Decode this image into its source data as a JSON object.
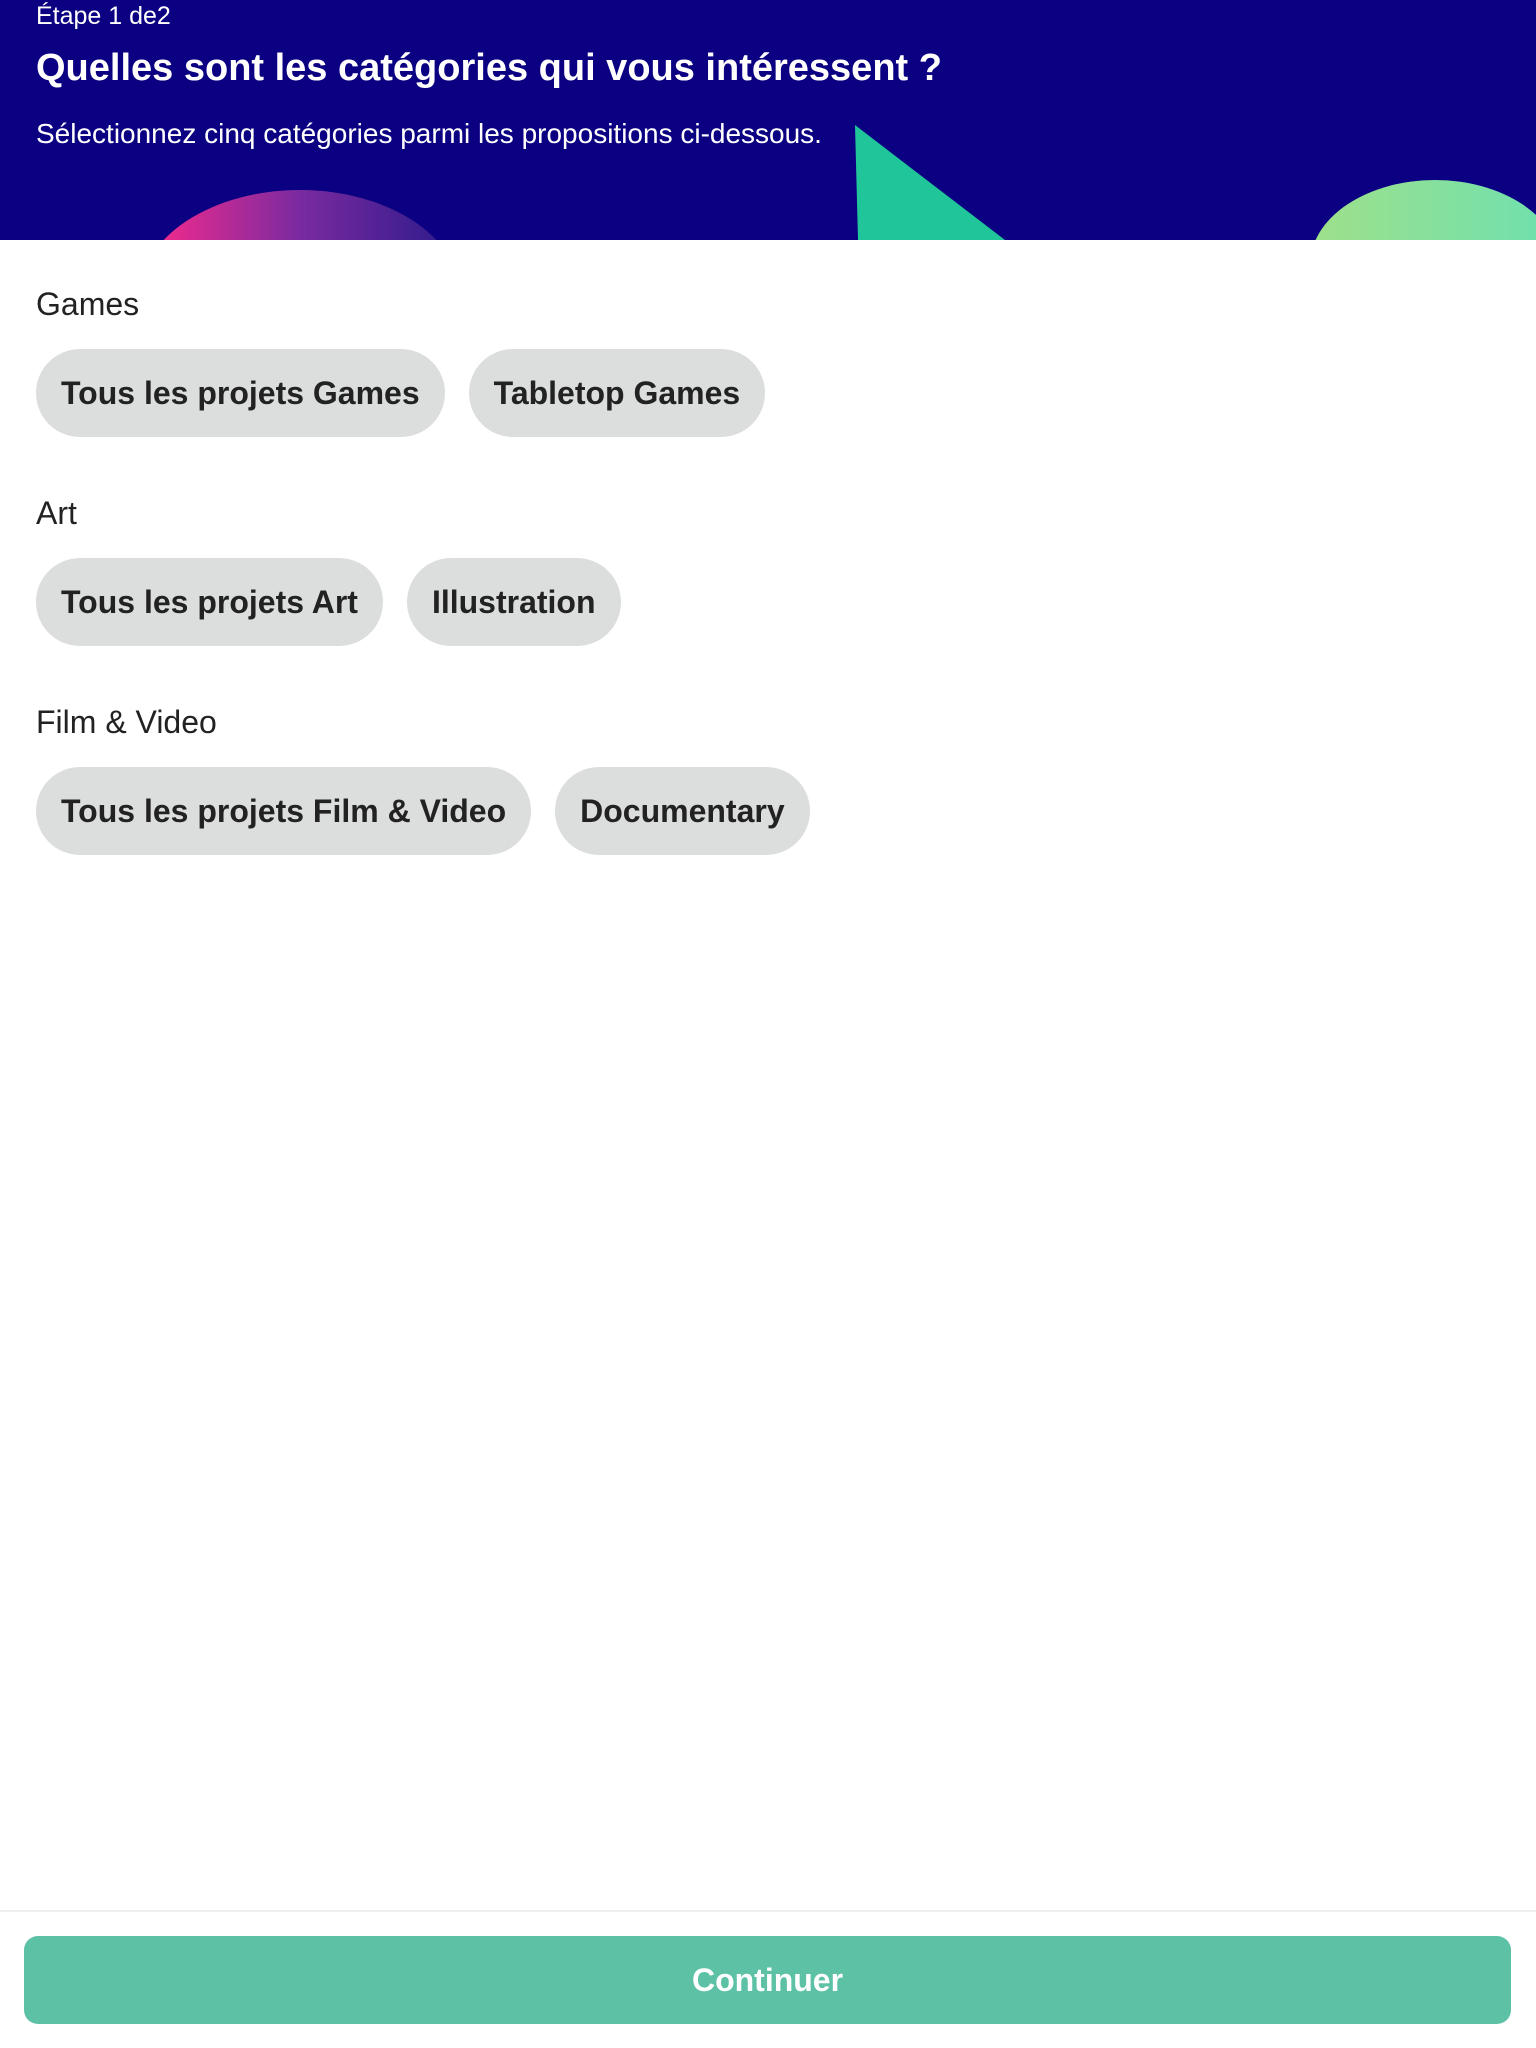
{
  "header": {
    "step": "Étape 1 de2",
    "title": "Quelles sont les catégories qui vous intéressent ?",
    "subtitle": "Sélectionnez cinq catégories parmi les propositions ci-dessous.",
    "background_color": "#0b0081"
  },
  "sections": [
    {
      "title": "Games",
      "chips": [
        "Tous les projets Games",
        "Tabletop Games"
      ]
    },
    {
      "title": "Art",
      "chips": [
        "Tous les projets Art",
        "Illustration"
      ]
    },
    {
      "title": "Film & Video",
      "chips": [
        "Tous les projets Film & Video",
        "Documentary"
      ]
    }
  ],
  "footer": {
    "continue_label": "Continuer",
    "button_color": "#5dc1a6"
  }
}
